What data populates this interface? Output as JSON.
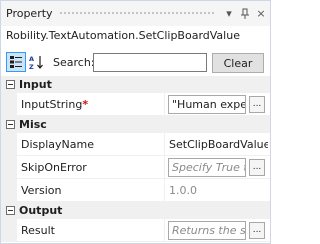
{
  "panel": {
    "title": "Property",
    "type_name": "Robility.TextAutomation.SetClipBoardValue"
  },
  "titlebar_icons": {
    "dropdown": "▾",
    "pin": "⊥",
    "close": "×"
  },
  "toolbar": {
    "search_label": "Search:",
    "search_value": "",
    "clear_label": "Clear"
  },
  "categories": {
    "input": {
      "label": "Input",
      "rows": {
        "input_string": {
          "name": "InputString",
          "required_mark": "*",
          "value": "\"Human exper",
          "ellipsis": "..."
        }
      }
    },
    "misc": {
      "label": "Misc",
      "rows": {
        "display_name": {
          "name": "DisplayName",
          "value": "SetClipBoardValue"
        },
        "skip_on_error": {
          "name": "SkipOnError",
          "placeholder": "Specify True to",
          "ellipsis": "..."
        },
        "version": {
          "name": "Version",
          "value": "1.0.0"
        }
      }
    },
    "output": {
      "label": "Output",
      "rows": {
        "result": {
          "name": "Result",
          "placeholder": "Returns the suc",
          "ellipsis": "..."
        }
      }
    }
  },
  "colors": {
    "accent": "#3399ff",
    "required": "#d01010",
    "category_bg": "#f0f0f0"
  }
}
